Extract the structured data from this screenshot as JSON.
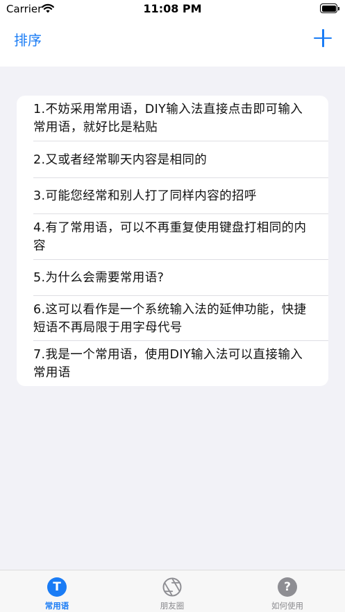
{
  "status_bar": {
    "carrier": "Carrier",
    "time": "11:08 PM"
  },
  "nav_bar": {
    "sort_label": "排序",
    "add_icon": "plus-icon",
    "accent_color": "#1a7cf5"
  },
  "phrases": [
    "1.不妨采用常用语，DIY输入法直接点击即可输入常用语，就好比是粘贴",
    "2.又或者经常聊天内容是相同的",
    "3.可能您经常和别人打了同样内容的招呼",
    "4.有了常用语，可以不再重复使用键盘打相同的内容",
    "5.为什么会需要常用语?",
    "6.这可以看作是一个系统输入法的延伸功能，快捷短语不再局限于用字母代号",
    "7.我是一个常用语，使用DIY输入法可以直接输入常用语"
  ],
  "tab_bar": {
    "tabs": [
      {
        "label": "常用语",
        "icon": "T",
        "icon_name": "text-t-icon",
        "selected": true
      },
      {
        "label": "朋友圈",
        "icon_name": "aperture-icon",
        "selected": false
      },
      {
        "label": "如何使用",
        "icon": "?",
        "icon_name": "help-icon",
        "selected": false
      }
    ]
  }
}
